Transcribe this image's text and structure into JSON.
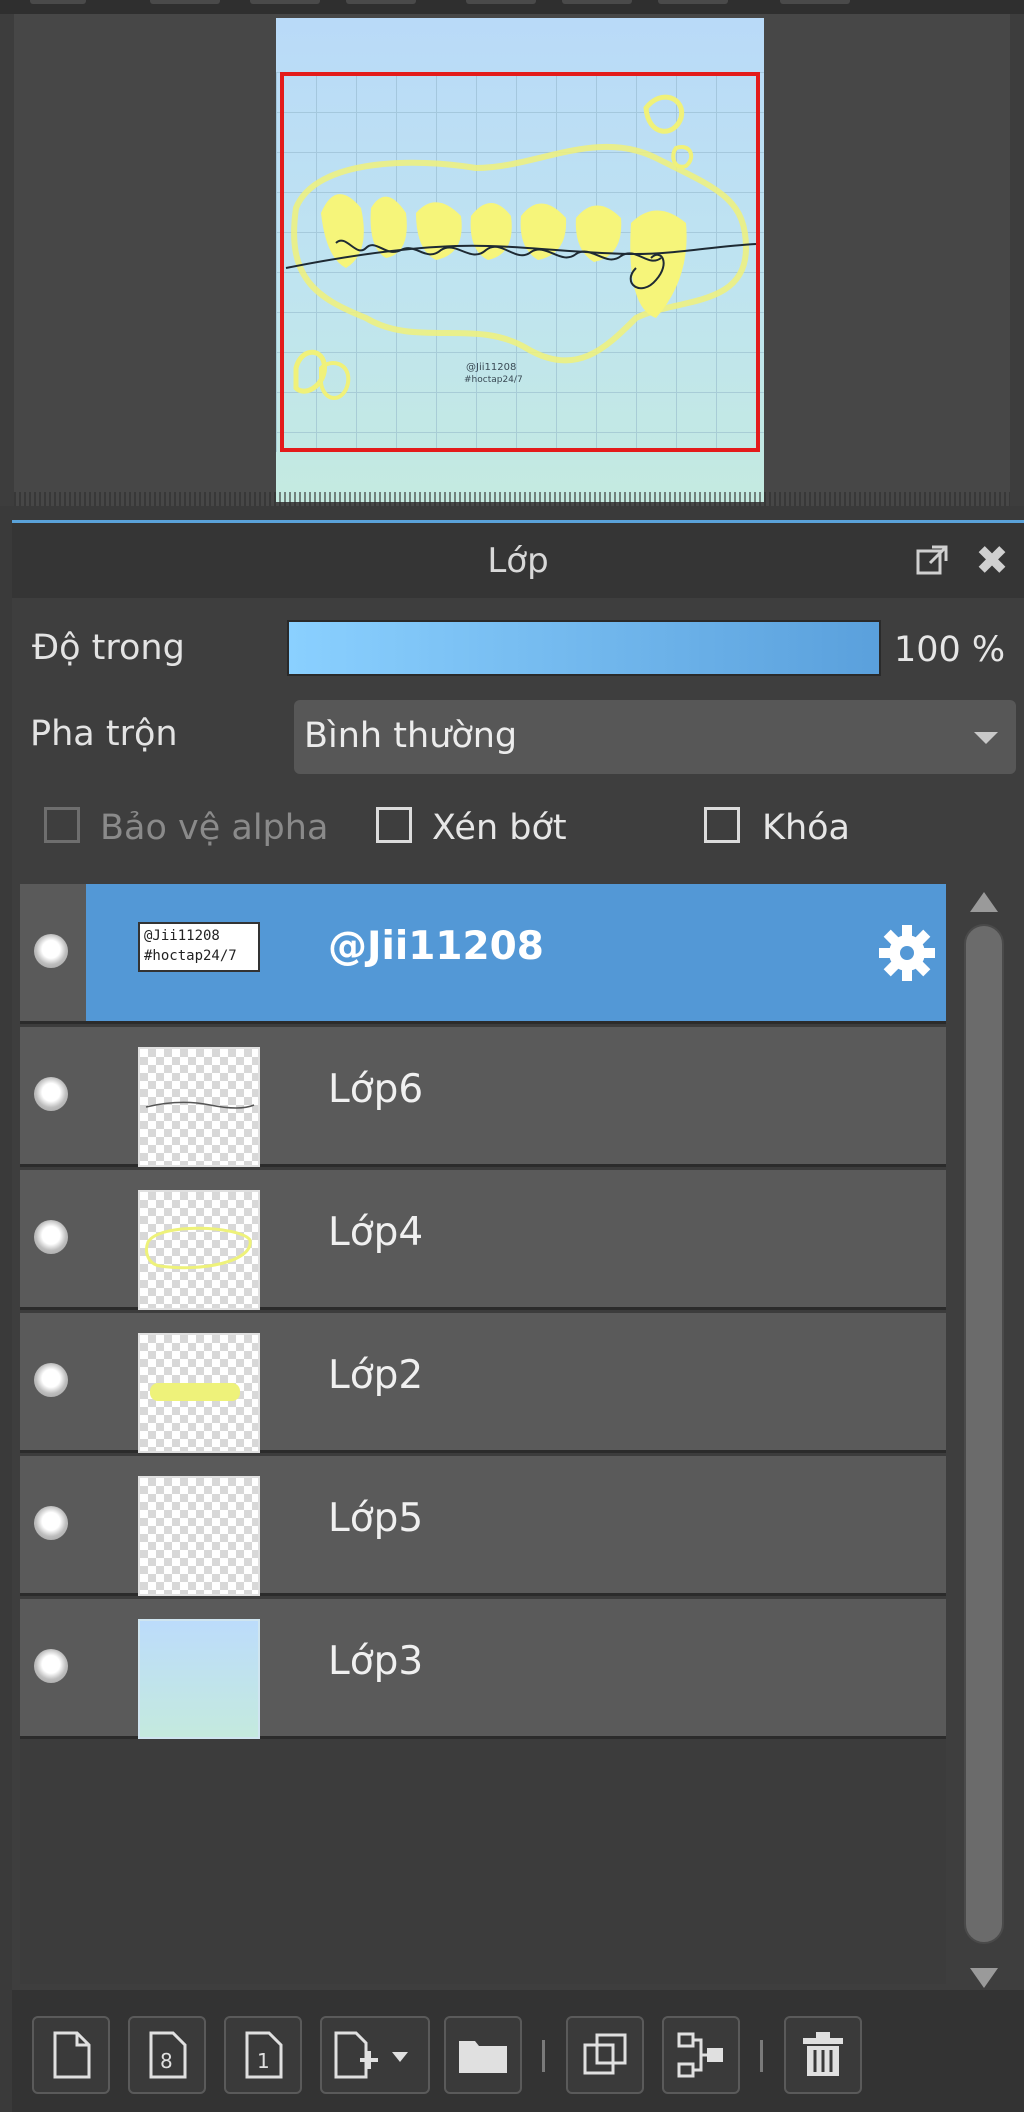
{
  "panel": {
    "title": "Lớp",
    "opacity_label": "Độ trong",
    "opacity_value": "100 %",
    "opacity_fraction": 1.0,
    "blend_label": "Pha trộn",
    "blend_value": "Bình thường",
    "checks": {
      "alpha_protect": "Bảo vệ alpha",
      "clip": "Xén bớt",
      "lock": "Khóa"
    }
  },
  "layers": [
    {
      "name": "@Jii11208",
      "selected": true,
      "thumb": "text",
      "thumb_text": "@Jii11208\n#hoctap24/7"
    },
    {
      "name": "Lớp6",
      "selected": false,
      "thumb": "checker"
    },
    {
      "name": "Lớp4",
      "selected": false,
      "thumb": "checker"
    },
    {
      "name": "Lớp2",
      "selected": false,
      "thumb": "checker"
    },
    {
      "name": "Lớp5",
      "selected": false,
      "thumb": "checker"
    },
    {
      "name": "Lớp3",
      "selected": false,
      "thumb": "gradient"
    }
  ],
  "canvas_art": {
    "handwriting": "thương",
    "watermark": "@Jii11208\n#hoctap24/7"
  },
  "colors": {
    "accent": "#5398d6",
    "frame": "#e31b1b",
    "panel_bg": "#3e3e3e"
  }
}
